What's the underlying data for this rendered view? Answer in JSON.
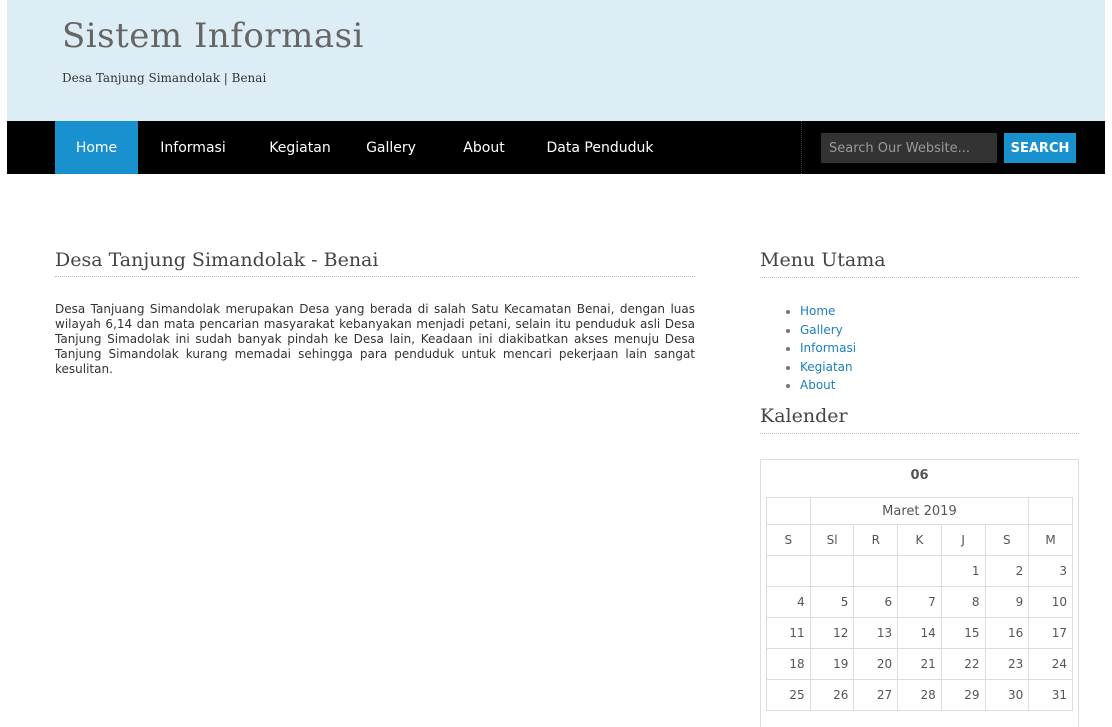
{
  "header": {
    "title": "Sistem Informasi",
    "subtitle": "Desa Tanjung Simandolak | Benai"
  },
  "nav": {
    "items": [
      "Home",
      "Informasi",
      "Kegiatan",
      "Gallery",
      "About",
      "Data Penduduk"
    ],
    "active": "Home",
    "search_placeholder": "Search Our Website...",
    "search_button": "SEARCH"
  },
  "post": {
    "title": "Desa Tanjung Simandolak - Benai",
    "body": "Desa Tanjuang Simandolak merupakan Desa yang berada di salah Satu Kecamatan Benai, dengan luas wilayah 6,14 dan mata pencarian masyarakat kebanyakan menjadi petani, selain itu penduduk asli Desa Tanjung Simadolak ini sudah banyak pindah ke Desa lain, Keadaan ini diakibatkan akses menuju Desa Tanjung Simandolak kurang memadai sehingga para penduduk untuk mencari pekerjaan lain sangat kesulitan."
  },
  "sidebar": {
    "menu_title": "Menu Utama",
    "menu_items": [
      "Home",
      "Gallery",
      "Informasi",
      "Kegiatan",
      "About"
    ],
    "calendar_title": "Kalender"
  },
  "calendar": {
    "day": "06",
    "month": "Maret 2019",
    "weekdays": [
      "S",
      "Sl",
      "R",
      "K",
      "J",
      "S",
      "M"
    ],
    "weeks": [
      [
        "",
        "",
        "",
        "",
        "1",
        "2",
        "3"
      ],
      [
        "4",
        "5",
        "6",
        "7",
        "8",
        "9",
        "10"
      ],
      [
        "11",
        "12",
        "13",
        "14",
        "15",
        "16",
        "17"
      ],
      [
        "18",
        "19",
        "20",
        "21",
        "22",
        "23",
        "24"
      ],
      [
        "25",
        "26",
        "27",
        "28",
        "29",
        "30",
        "31"
      ]
    ]
  },
  "colors": {
    "accent": "#1a91cf",
    "header_bg": "#ddedf6",
    "nav_bg": "#000000",
    "link": "#1a7fc0"
  }
}
